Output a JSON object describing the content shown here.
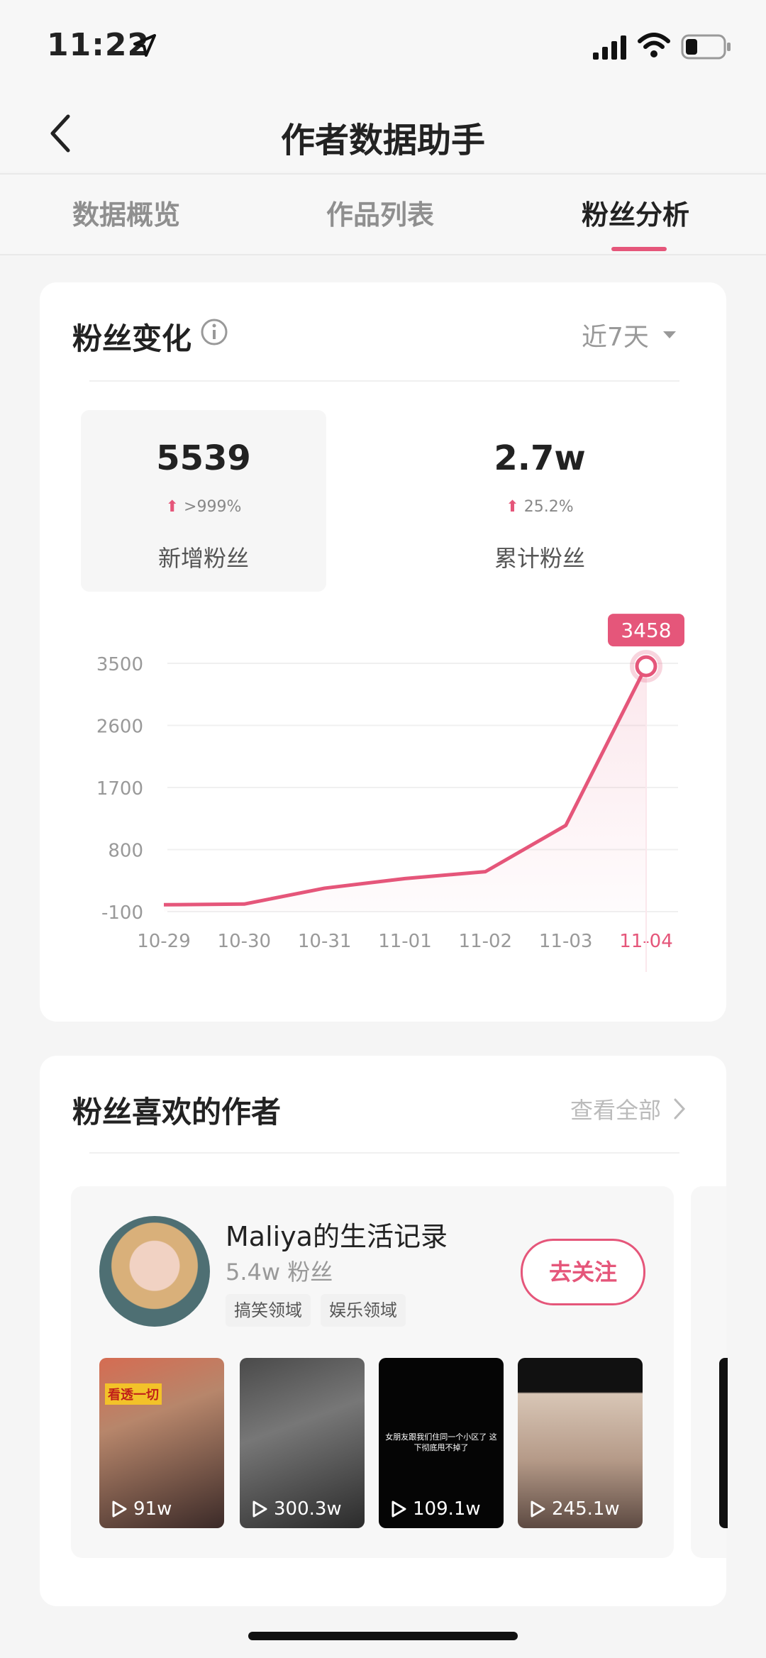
{
  "status_bar": {
    "time": "11:22"
  },
  "nav": {
    "title": "作者数据助手"
  },
  "tabs": [
    {
      "label": "数据概览",
      "active": false
    },
    {
      "label": "作品列表",
      "active": false
    },
    {
      "label": "粉丝分析",
      "active": true
    }
  ],
  "fans_change": {
    "title": "粉丝变化",
    "range_label": "近7天",
    "new_fans": {
      "value": "5539",
      "delta": ">999%",
      "label": "新增粉丝"
    },
    "total_fans": {
      "value": "2.7w",
      "delta": "25.2%",
      "label": "累计粉丝"
    }
  },
  "chart_data": {
    "type": "line",
    "categories": [
      "10-29",
      "10-30",
      "10-31",
      "11-01",
      "11-02",
      "11-03",
      "11-04"
    ],
    "series": [
      {
        "values": [
          0,
          10,
          240,
          380,
          480,
          1150,
          3458
        ]
      }
    ],
    "yticks": [
      "3500",
      "2600",
      "1700",
      "800",
      "-100"
    ],
    "ylim": [
      -100,
      3500
    ],
    "highlight": {
      "category": "11-04",
      "label": "3458"
    },
    "grid": true,
    "colors": {
      "line": "#e5567a",
      "highlight": "#e5567a"
    }
  },
  "liked_authors": {
    "title": "粉丝喜欢的作者",
    "view_all": "查看全部",
    "author": {
      "name": "Maliya的生活记录",
      "followers": "5.4w 粉丝",
      "tags": [
        "搞笑领域",
        "娱乐领域"
      ],
      "follow_label": "去关注",
      "videos": [
        {
          "views": "91w",
          "caption": "看透一切"
        },
        {
          "views": "300.3w",
          "caption": ""
        },
        {
          "views": "109.1w",
          "caption": "女朋友跟我们住同一个小区了 这下彻底甩不掉了"
        },
        {
          "views": "245.1w",
          "caption": ""
        }
      ]
    }
  },
  "colors": {
    "accent": "#e5567a",
    "background": "#f5f5f5"
  }
}
